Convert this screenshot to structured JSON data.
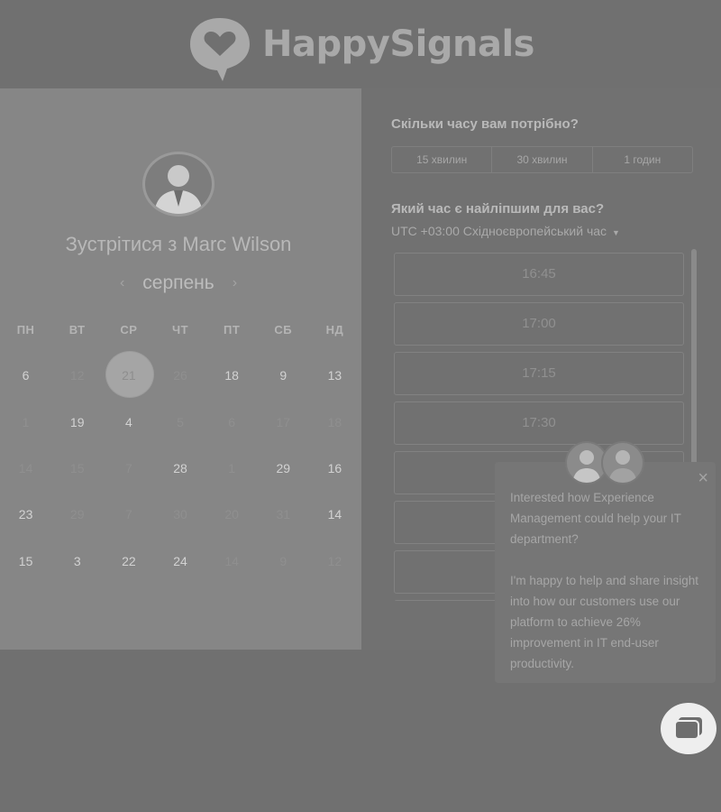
{
  "header": {
    "brand": "HappySignals"
  },
  "calendar": {
    "title": "Зустрітися з Marc Wilson",
    "month": "серпень",
    "prev_label": "‹",
    "next_label": "›",
    "weekdays": [
      "ПН",
      "ВТ",
      "СР",
      "ЧТ",
      "ПТ",
      "СБ",
      "НД"
    ],
    "weeks": [
      [
        "6",
        "12",
        "21",
        "26",
        "18",
        "9",
        "13"
      ],
      [
        "1",
        "19",
        "4",
        "5",
        "6",
        "17",
        "18"
      ],
      [
        "14",
        "15",
        "7",
        "28",
        "1",
        "29",
        "16"
      ],
      [
        "23",
        "29",
        "7",
        "30",
        "20",
        "31",
        "14"
      ],
      [
        "15",
        "3",
        "22",
        "24",
        "14",
        "9",
        "12"
      ]
    ],
    "selected_day": "21"
  },
  "duration": {
    "question": "Скільки часу вам потрібно?",
    "options": [
      "15 хвилин",
      "30 хвилин",
      "1 годин"
    ]
  },
  "timeslots": {
    "question": "Який час є найліпшим для вас?",
    "timezone": "UTC +03:00 Східноєвропейський час",
    "slots": [
      "16:45",
      "17:00",
      "17:15",
      "17:30",
      "",
      "",
      "",
      ""
    ]
  },
  "chat": {
    "message_1": "Interested how Experience Management could help your IT department?",
    "message_2": "I'm happy to help and share insight into how our customers use our platform to achieve 26% improvement in IT end-user productivity.",
    "close_label": "×"
  }
}
